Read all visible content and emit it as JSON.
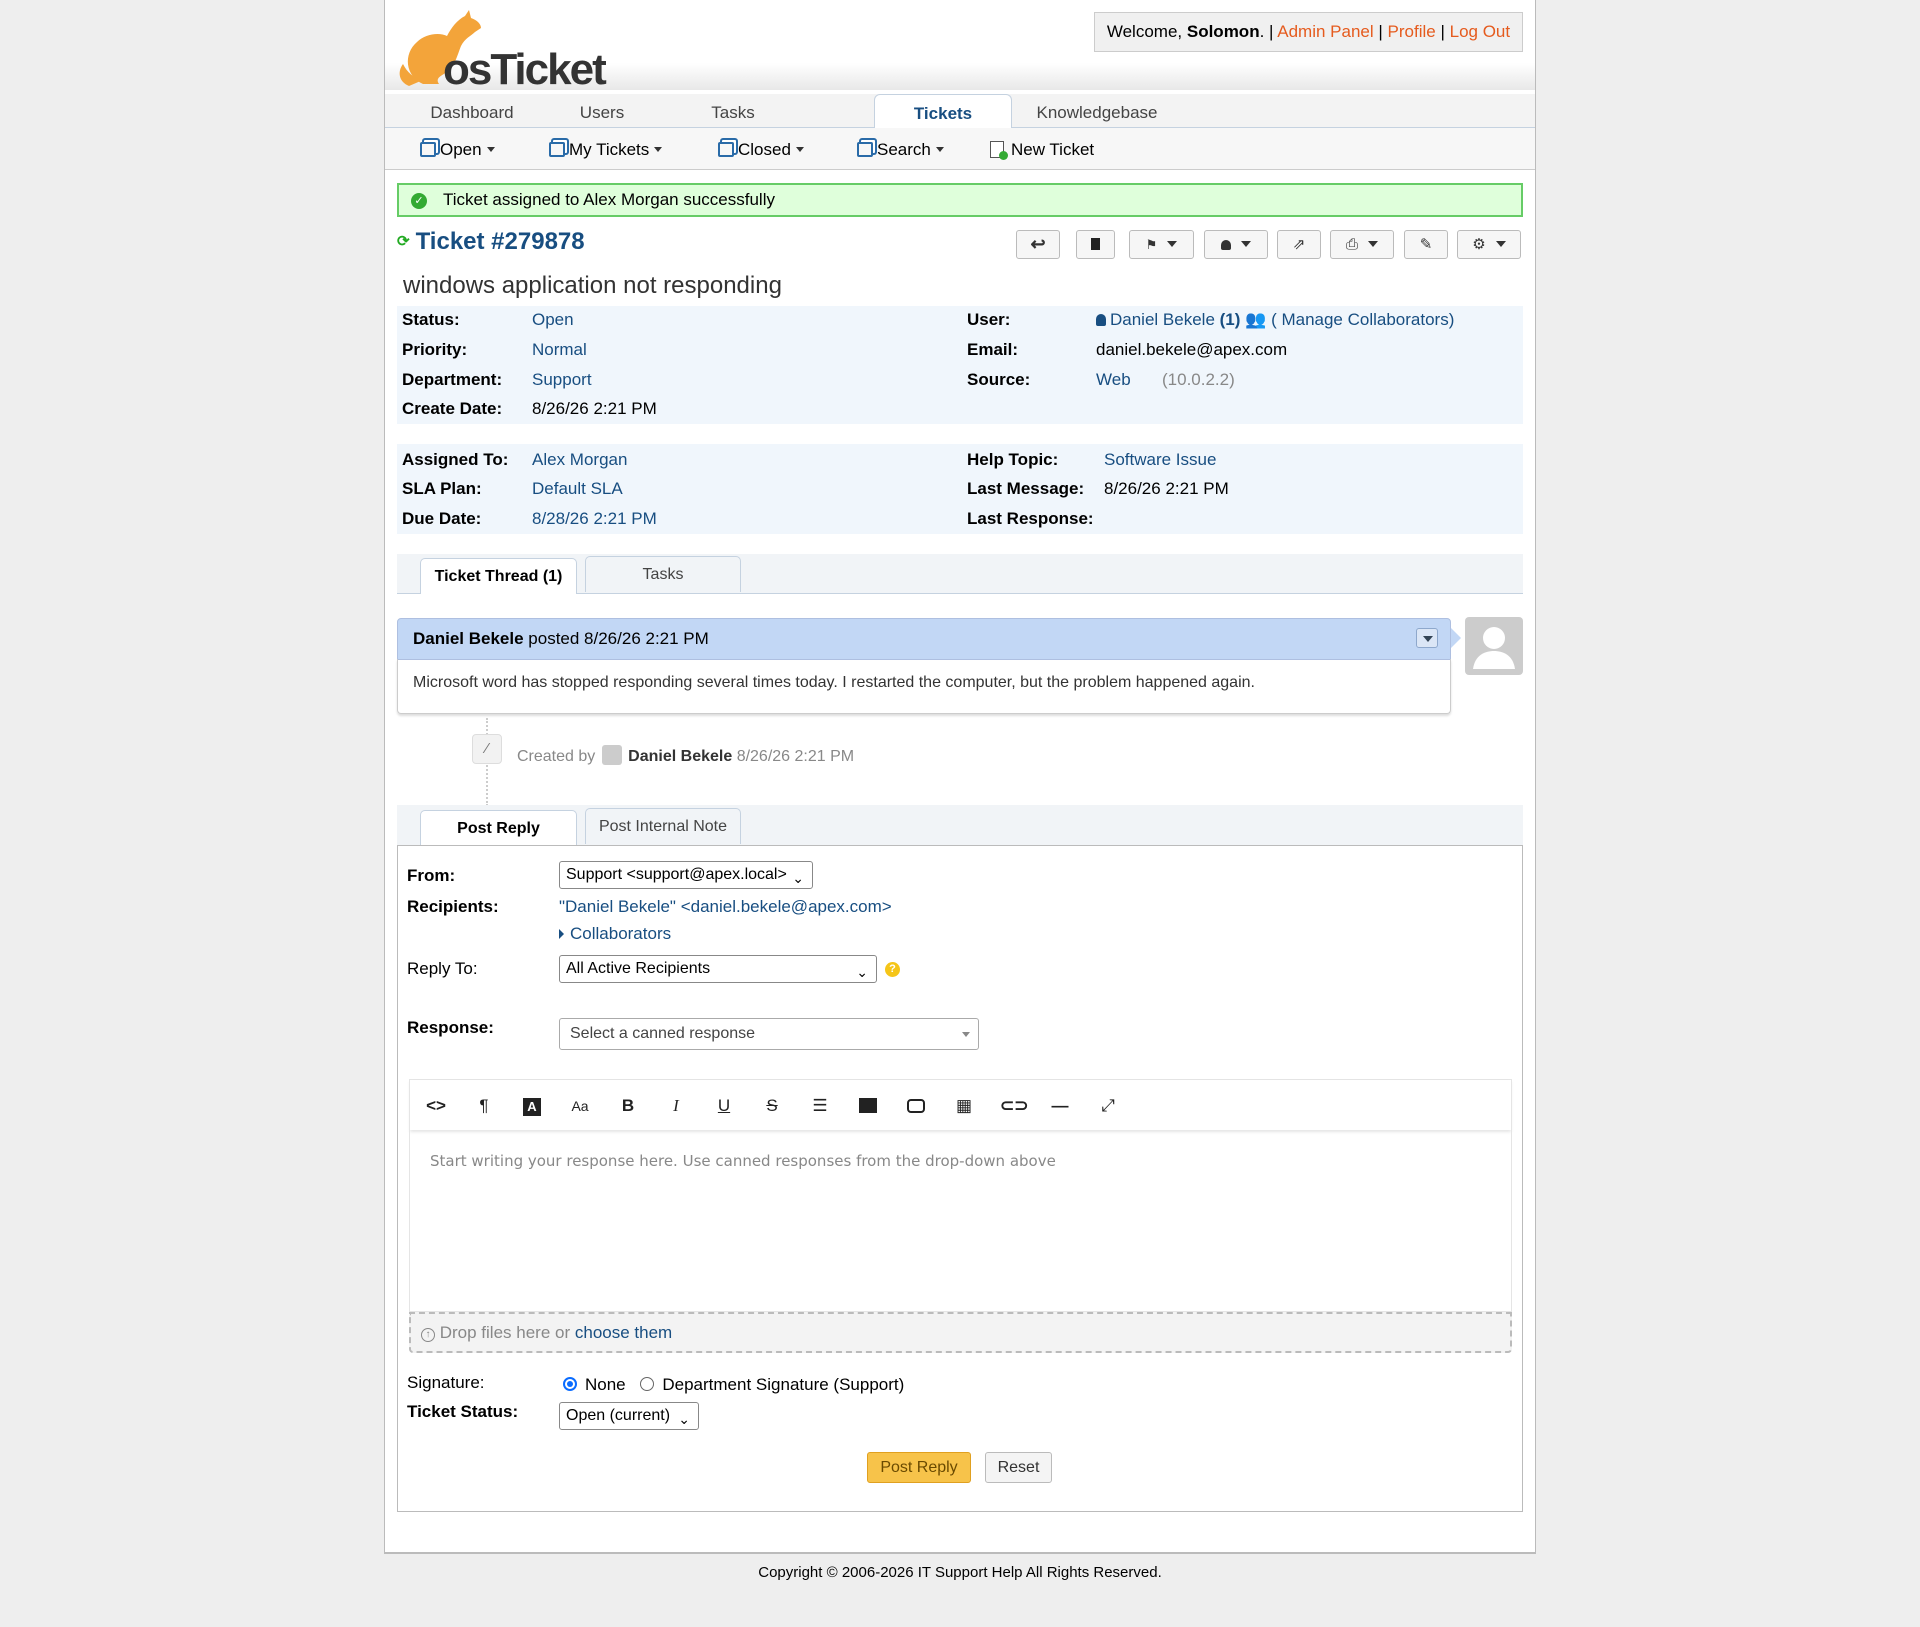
{
  "header": {
    "logo_text": "osTicket",
    "welcome_prefix": "Welcome, ",
    "user_name": "Solomon",
    "welcome_suffix": ".",
    "sep": "|",
    "admin_panel": "Admin Panel",
    "profile": "Profile",
    "logout": "Log Out"
  },
  "nav": {
    "tabs": [
      "Dashboard",
      "Users",
      "Tasks",
      "Tickets",
      "Knowledgebase"
    ],
    "active": "Tickets"
  },
  "subnav": {
    "open": "Open",
    "my_tickets": "My Tickets",
    "closed": "Closed",
    "search": "Search",
    "new_ticket": "New Ticket"
  },
  "alert": {
    "text": "Ticket assigned to Alex Morgan successfully"
  },
  "ticket": {
    "number": "Ticket #279878",
    "subject": "windows application not responding",
    "status_label": "Status:",
    "status": "Open",
    "priority_label": "Priority:",
    "priority": "Normal",
    "department_label": "Department:",
    "department": "Support",
    "create_date_label": "Create Date:",
    "create_date": "8/26/26 2:21 PM",
    "user_label": "User:",
    "user": "Daniel Bekele",
    "user_count": "(1)",
    "manage_collab": "( Manage Collaborators)",
    "email_label": "Email:",
    "email": "daniel.bekele@apex.com",
    "source_label": "Source:",
    "source": "Web",
    "source_ip": "(10.0.2.2)",
    "assigned_label": "Assigned To:",
    "assigned": "Alex Morgan",
    "sla_label": "SLA Plan:",
    "sla": "Default SLA",
    "due_label": "Due Date:",
    "due": "8/28/26 2:21 PM",
    "help_topic_label": "Help Topic:",
    "help_topic": "Software Issue",
    "last_message_label": "Last Message:",
    "last_message": "8/26/26 2:21 PM",
    "last_response_label": "Last Response:",
    "last_response": ""
  },
  "thread_tabs": {
    "thread": "Ticket Thread (1)",
    "tasks": "Tasks"
  },
  "thread": {
    "poster": "Daniel Bekele",
    "posted_text": " posted 8/26/26 2:21 PM",
    "body": "Microsoft word has stopped responding several times today. I restarted the computer, but the problem happened again.",
    "event_prefix": "Created by",
    "event_user": "Daniel Bekele",
    "event_time": "8/26/26 2:21 PM"
  },
  "reply_tabs": {
    "post_reply": "Post Reply",
    "internal_note": "Post Internal Note"
  },
  "reply": {
    "from_label": "From:",
    "from_value": "Support <support@apex.local>",
    "recipients_label": "Recipients:",
    "recipients_value": "\"Daniel Bekele\" <daniel.bekele@apex.com>",
    "collaborators": "Collaborators",
    "reply_to_label": "Reply To:",
    "reply_to_value": "All Active Recipients",
    "response_label": "Response:",
    "response_placeholder": "Select a canned response",
    "editor_placeholder": "Start writing your response here. Use canned responses from the drop-down above",
    "drop_text": "Drop files here or ",
    "drop_link": "choose them",
    "signature_label": "Signature:",
    "sig_none": "None",
    "sig_dept": "Department Signature (Support)",
    "status_label": "Ticket Status:",
    "status_value": "Open (current)",
    "post_button": "Post Reply",
    "reset_button": "Reset"
  },
  "footer": {
    "text": "Copyright © 2006-2026 IT Support Help All Rights Reserved."
  },
  "colors": {
    "accent": "#184e81",
    "orange": "#e55b1e",
    "post_button": "#f7c34a"
  }
}
